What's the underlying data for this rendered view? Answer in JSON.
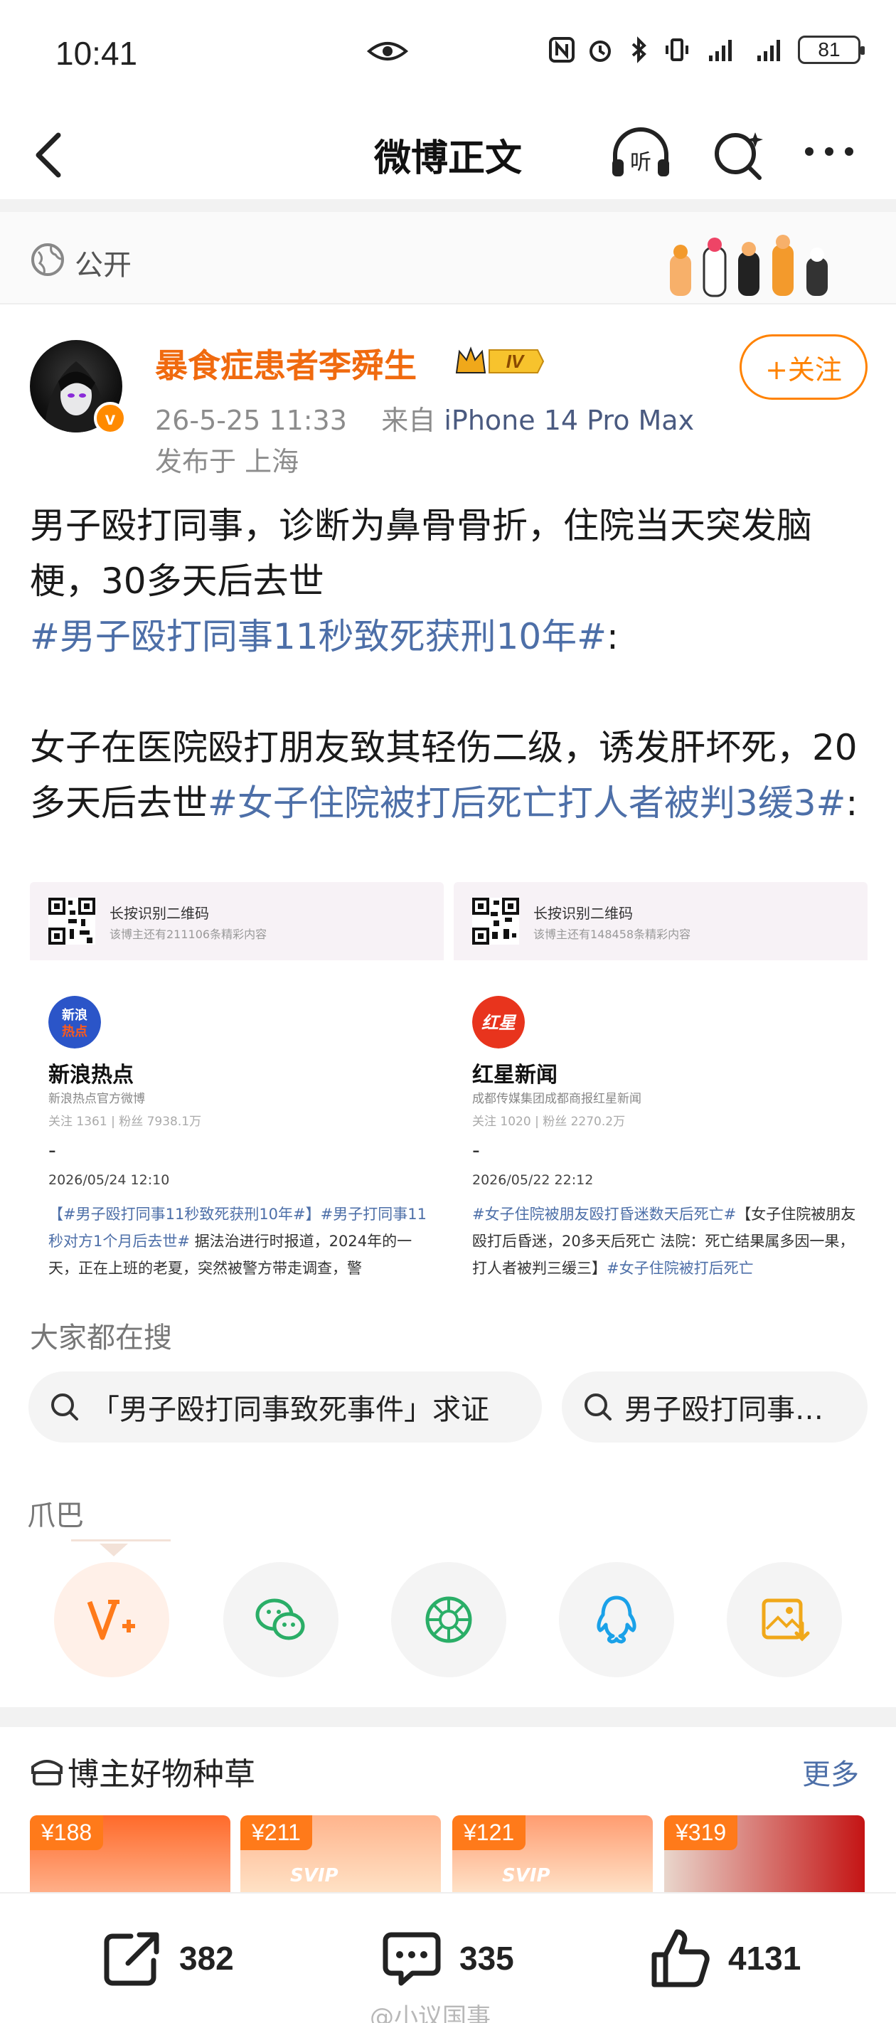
{
  "status_bar": {
    "time": "10:41",
    "battery": "81"
  },
  "header": {
    "title": "微博正文"
  },
  "visibility": {
    "label": "公开"
  },
  "author": {
    "name": "暴食症患者李舜生",
    "vip_label": "IV",
    "verified": "v",
    "time": "26-5-25 11:33",
    "source_prefix": "来自",
    "device": "iPhone 14 Pro Max",
    "location": "发布于 上海",
    "follow_label": "+关注"
  },
  "post": {
    "para1": "男子殴打同事，诊断为鼻骨骨折，住院当天突发脑梗，30多天后去世",
    "topic1": "#男子殴打同事11秒致死获刑10年#",
    "colon1": ":",
    "para2": "女子在医院殴打朋友致其轻伤二级，诱发肝坏死，20多天后去世",
    "topic2": "#女子住院被打后死亡打人者被判3缓3#",
    "colon2": ":"
  },
  "cards": [
    {
      "qr_title": "长按识别二维码",
      "qr_sub": "该博主还有211106条精彩内容",
      "logo_text": "新浪热点",
      "name": "新浪热点",
      "desc": "新浪热点官方微博",
      "stats": "关注 1361  |  粉丝 7938.1万",
      "dash": "-",
      "date": "2026/05/24 12:10",
      "topic": "【#男子殴打同事11秒致死获刑10年#】#男子打同事11秒对方1个月后去世#",
      "text": "据法治进行时报道，2024年的一天，正在上班的老夏，突然被警方带走调查，警"
    },
    {
      "qr_title": "长按识别二维码",
      "qr_sub": "该博主还有148458条精彩内容",
      "logo_text": "红星",
      "name": "红星新闻",
      "desc": "成都传媒集团成都商报红星新闻",
      "stats": "关注 1020  |  粉丝 2270.2万",
      "dash": "-",
      "date": "2026/05/22 22:12",
      "topic": "#女子住院被朋友殴打昏迷数天后死亡#",
      "text": "【女子住院被朋友殴打后昏迷，20多天后死亡 法院：死亡结果属多因一果，打人者被判三缓三】",
      "topic_end": "#女子住院被打后死亡"
    }
  ],
  "search_section": {
    "heading": "大家都在搜",
    "chips": [
      "「男子殴打同事致死事件」求证",
      "男子殴打同事…"
    ]
  },
  "share_section": {
    "heading": "爪巴"
  },
  "goods_section": {
    "heading": "博主好物种草",
    "more": "更多",
    "items": [
      {
        "price": "¥188",
        "tag": ""
      },
      {
        "price": "¥211",
        "tag": "SVIP"
      },
      {
        "price": "¥121",
        "tag": "SVIP"
      },
      {
        "price": "¥319",
        "tag": ""
      }
    ]
  },
  "actions": {
    "repost_count": "382",
    "comment_count": "335",
    "like_count": "4131"
  },
  "watermark": "@小议国事",
  "colors": {
    "accent": "#ff8200",
    "topic": "#4d6fa8",
    "author": "#f06a0f"
  }
}
